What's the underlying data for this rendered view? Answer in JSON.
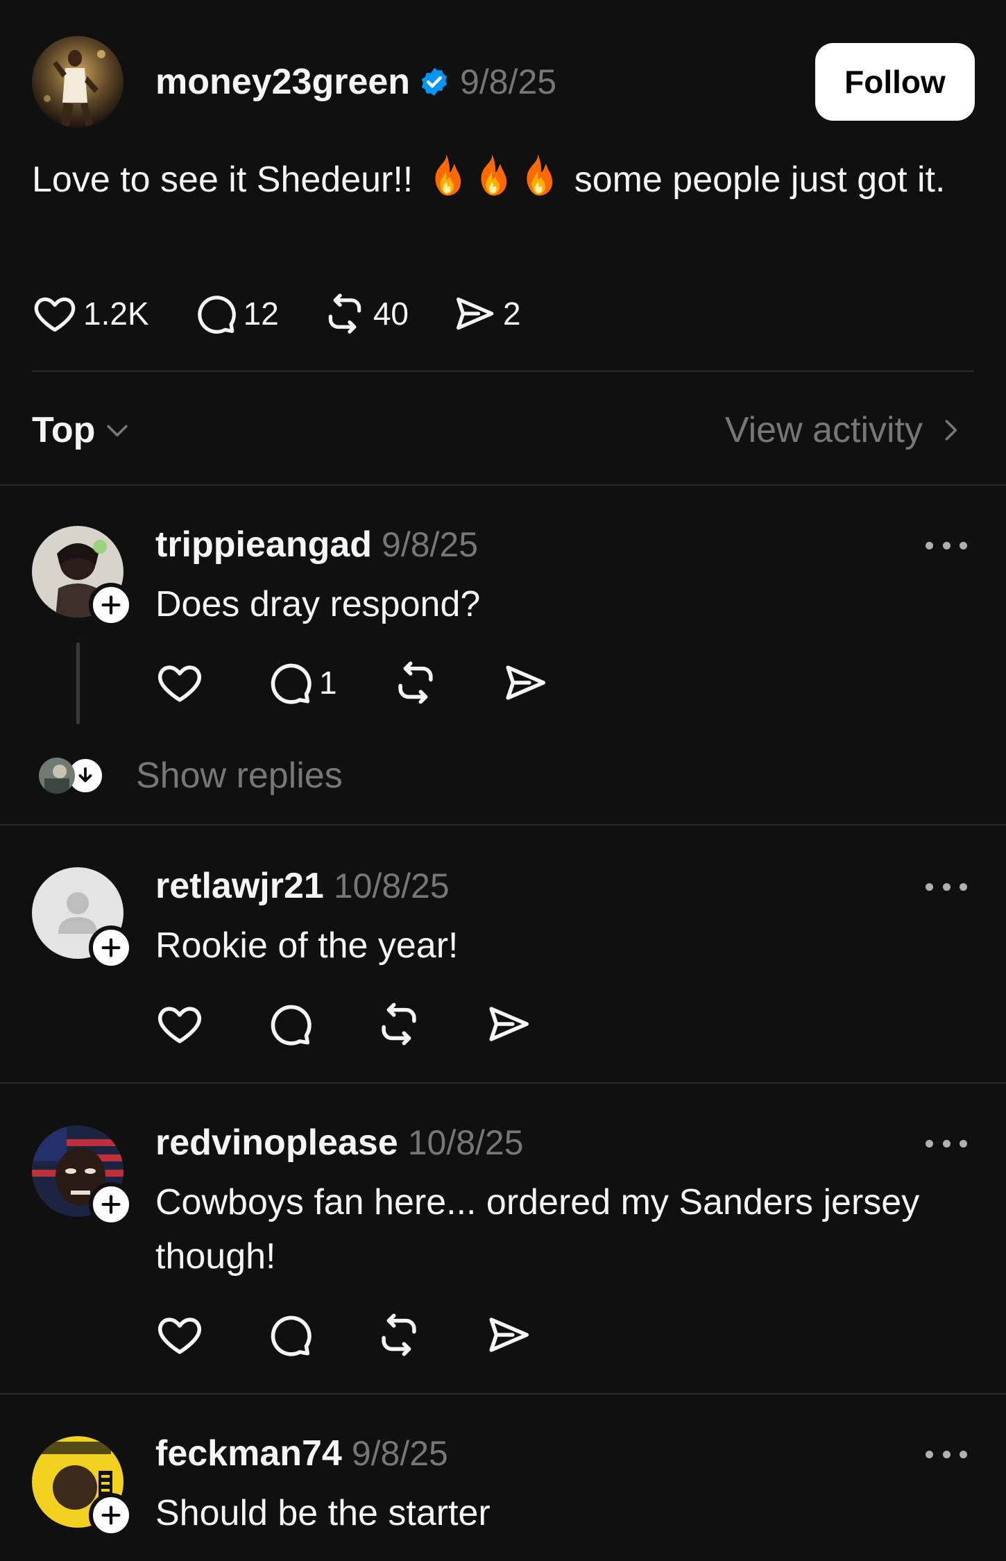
{
  "post": {
    "username": "money23green",
    "verified": true,
    "date": "9/8/25",
    "follow_label": "Follow",
    "text_before": "Love to see it Shedeur!!",
    "text_after": "some people just got it.",
    "emoji": "fire",
    "stats": {
      "likes": "1.2K",
      "replies": "12",
      "reposts": "40",
      "shares": "2"
    }
  },
  "sort": {
    "label": "Top",
    "view_activity": "View activity"
  },
  "comments": [
    {
      "username": "trippieangad",
      "date": "9/8/25",
      "text": "Does dray respond?",
      "reply_count": "1",
      "show_replies": "Show replies"
    },
    {
      "username": "retlawjr21",
      "date": "10/8/25",
      "text": "Rookie of the year!"
    },
    {
      "username": "redvinoplease",
      "date": "10/8/25",
      "text": "Cowboys fan here... ordered my Sanders jersey though!"
    },
    {
      "username": "feckman74",
      "date": "9/8/25",
      "text": "Should be the starter"
    }
  ],
  "colors": {
    "background": "#101010",
    "primary_text": "#f3f5f7",
    "secondary_text": "#777777",
    "divider": "#2b2b2b",
    "verified_blue": "#0095f6"
  },
  "icons": {
    "like": "heart-icon",
    "reply": "comment-bubble-icon",
    "repost": "repost-icon",
    "share": "share-send-icon",
    "more": "more-dots-icon",
    "follow_plus": "plus-icon",
    "verified": "verified-badge-icon"
  }
}
